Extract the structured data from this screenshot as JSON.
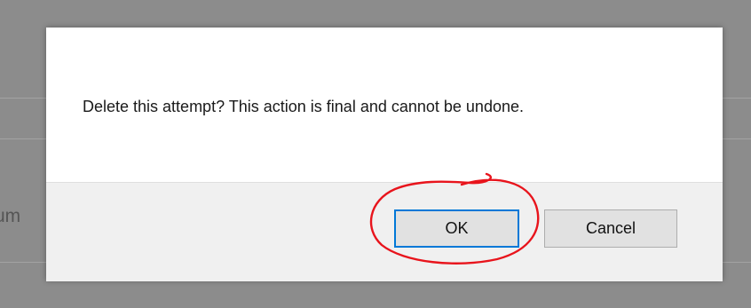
{
  "background": {
    "partial_text": "um"
  },
  "dialog": {
    "message": "Delete this attempt? This action is final and cannot be undone.",
    "ok_label": "OK",
    "cancel_label": "Cancel"
  },
  "colors": {
    "backdrop": "#8c8c8c",
    "dialog_body": "#ffffff",
    "dialog_footer": "#f0f0f0",
    "focus_border": "#0078d7",
    "annotation": "#e8141c"
  }
}
